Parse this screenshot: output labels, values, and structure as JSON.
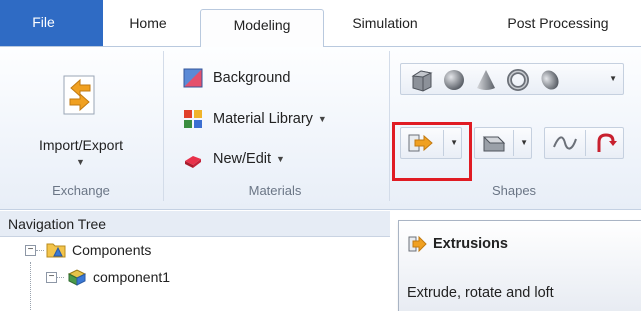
{
  "tabs": {
    "file": "File",
    "home": "Home",
    "modeling": "Modeling",
    "simulation": "Simulation",
    "post_processing": "Post Processing"
  },
  "ribbon": {
    "exchange": {
      "import_export_label": "Import/Export",
      "group_label": "Exchange"
    },
    "materials": {
      "background_label": "Background",
      "material_library_label": "Material Library",
      "new_edit_label": "New/Edit",
      "group_label": "Materials"
    },
    "shapes": {
      "group_label": "Shapes",
      "row1_icons": [
        "brick-icon",
        "sphere-icon",
        "cone-icon",
        "torus-icon",
        "ellipsoid-icon"
      ],
      "highlighted": "extrusions-button"
    }
  },
  "navigation_tree": {
    "title": "Navigation Tree",
    "items": [
      {
        "label": "Components",
        "expanded": true
      },
      {
        "label": "component1",
        "expanded": true
      }
    ]
  },
  "tooltip": {
    "title": "Extrusions",
    "description": "Extrude, rotate and loft"
  },
  "colors": {
    "file_tab": "#2f6bc4",
    "highlight": "#e01b23",
    "accent_orange": "#f0a020"
  }
}
